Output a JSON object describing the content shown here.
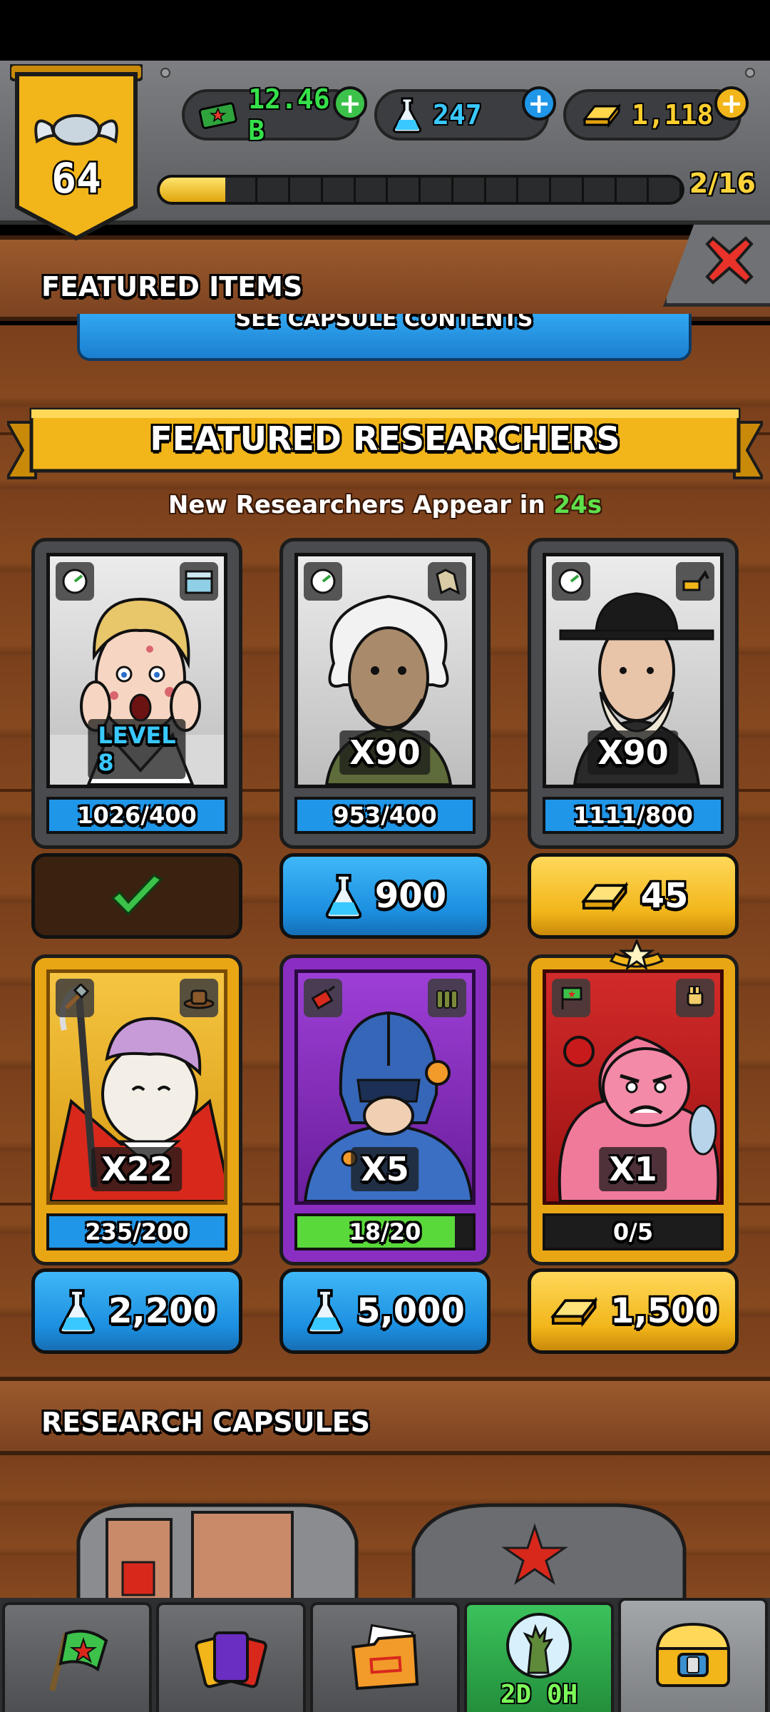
{
  "player": {
    "level": "64"
  },
  "resources": {
    "cash": {
      "value": "12.46 B",
      "icon": "cash-icon",
      "color": "#35e04a"
    },
    "flasks": {
      "value": "247",
      "icon": "flask-icon",
      "color": "#39c8ff"
    },
    "gold": {
      "value": "1,118",
      "icon": "gold-bar-icon",
      "color": "#ffcf2e"
    }
  },
  "xp": {
    "label": "2/16",
    "progress": 0.125,
    "segments": 16
  },
  "section": {
    "title": "FEATURED ITEMS"
  },
  "capsule_contents": {
    "label": "SEE CAPSULE CONTENTS"
  },
  "featured": {
    "title": "FEATURED RESEARCHERS",
    "subtitle_prefix": "New Researchers Appear in ",
    "timer": "24s"
  },
  "researchers": [
    {
      "label": "LEVEL 8",
      "label_color": "#39c8ff",
      "progress": "1026/400",
      "ratio": 1.0,
      "bar": "#1f96e8",
      "frame": "#4a4b4e",
      "purchased": true,
      "price": "",
      "currency": ""
    },
    {
      "label": "X90",
      "label_color": "#ffffff",
      "progress": "953/400",
      "ratio": 1.0,
      "bar": "#1f96e8",
      "frame": "#4a4b4e",
      "purchased": false,
      "price": "900",
      "currency": "flask"
    },
    {
      "label": "X90",
      "label_color": "#ffffff",
      "progress": "1111/800",
      "ratio": 1.0,
      "bar": "#1f96e8",
      "frame": "#4a4b4e",
      "purchased": false,
      "price": "45",
      "currency": "gold"
    },
    {
      "label": "X22",
      "label_color": "#ffffff",
      "progress": "235/200",
      "ratio": 1.0,
      "bar": "#1f96e8",
      "frame": "#e8a614",
      "purchased": false,
      "price": "2,200",
      "currency": "flask"
    },
    {
      "label": "X5",
      "label_color": "#ffffff",
      "progress": "18/20",
      "ratio": 0.9,
      "bar": "#5ad93a",
      "frame": "#8a2ec2",
      "purchased": false,
      "price": "5,000",
      "currency": "flask"
    },
    {
      "label": "X1",
      "label_color": "#ffffff",
      "progress": "0/5",
      "ratio": 0.0,
      "bar": "#1f96e8",
      "frame": "#e8a614",
      "purchased": false,
      "price": "1,500",
      "currency": "gold"
    }
  ],
  "capsules": {
    "title": "RESEARCH CAPSULES"
  },
  "nav": {
    "tabs": [
      "flag-icon",
      "cards-icon",
      "folder-icon",
      "event-icon",
      "chest-icon"
    ],
    "event_timer": "2D 0H"
  }
}
